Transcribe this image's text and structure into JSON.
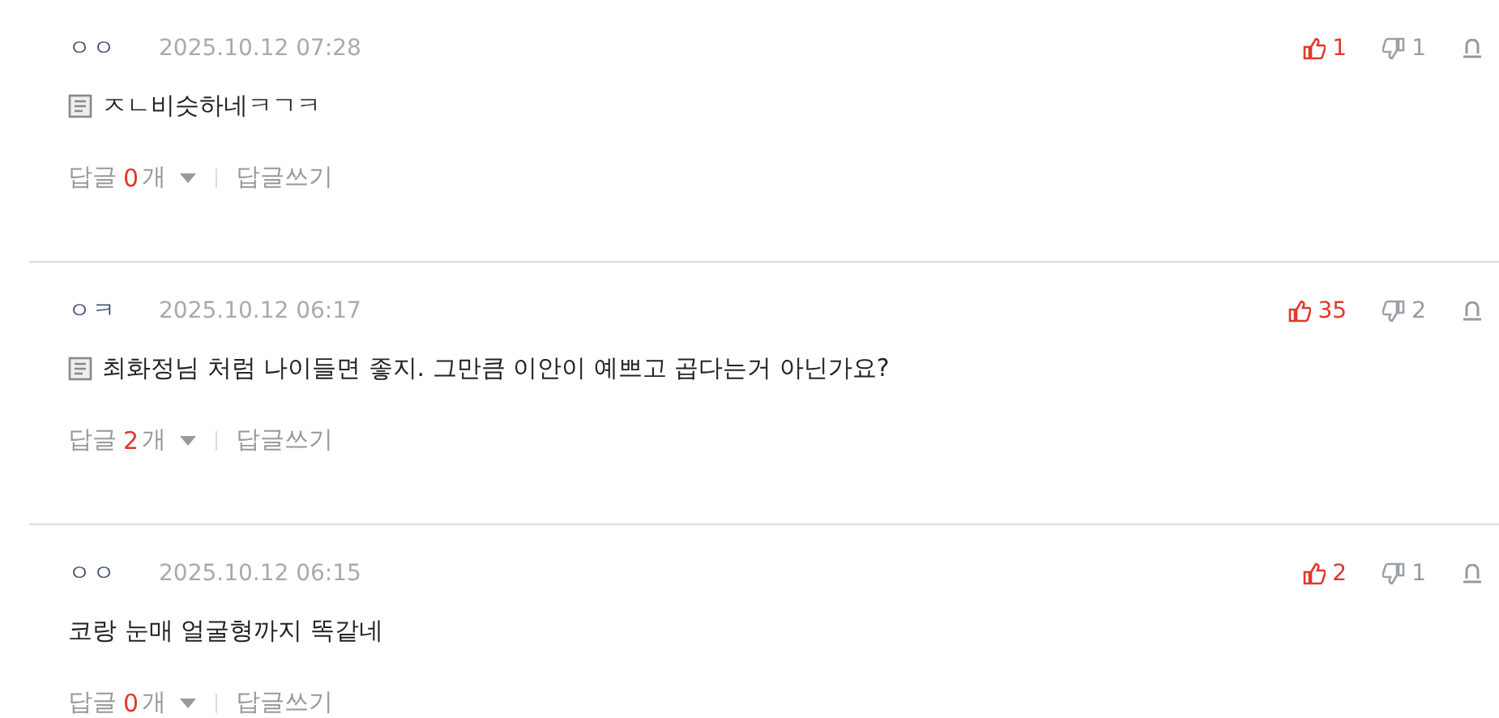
{
  "comments": [
    {
      "author": "ㅇㅇ",
      "date": "2025.10.12 07:28",
      "memo_icon": true,
      "text": "ㅈㄴ비슷하네ㅋㄱㅋ",
      "likes": "1",
      "dislikes": "1",
      "reply_label": "답글",
      "reply_count": "0",
      "reply_unit": "개",
      "write_label": "답글쓰기"
    },
    {
      "author": "ㅇㅋ",
      "date": "2025.10.12 06:17",
      "memo_icon": true,
      "text": "최화정님 처럼 나이들면 좋지. 그만큼 이안이 예쁘고 곱다는거 아닌가요?",
      "likes": "35",
      "dislikes": "2",
      "reply_label": "답글",
      "reply_count": "2",
      "reply_unit": "개",
      "write_label": "답글쓰기"
    },
    {
      "author": "ㅇㅇ",
      "date": "2025.10.12 06:15",
      "memo_icon": false,
      "text": "코랑 눈매 얼굴형까지 똑같네",
      "likes": "2",
      "dislikes": "1",
      "reply_label": "답글",
      "reply_count": "0",
      "reply_unit": "개",
      "write_label": "답글쓰기"
    }
  ]
}
